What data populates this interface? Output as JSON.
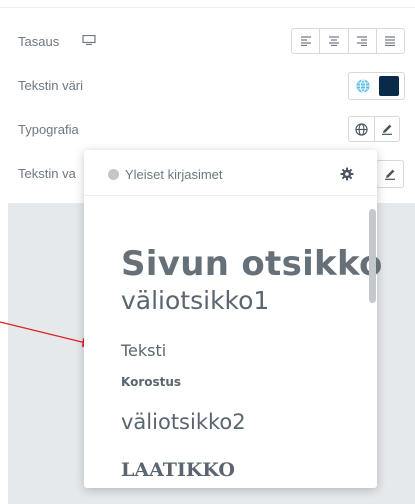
{
  "controls": {
    "alignment": {
      "label": "Tasaus",
      "icon": "monitor-icon",
      "options": [
        "align-left-icon",
        "align-center-icon",
        "align-right-icon",
        "align-justify-icon"
      ]
    },
    "text_color": {
      "label": "Tekstin väri",
      "globe_icon": "globe-icon",
      "swatch_color": "#0a2a4a"
    },
    "typography": {
      "label": "Typografia",
      "globe_icon": "globe-icon",
      "edit_icon": "pencil-icon"
    },
    "text_stroke": {
      "label": "Tekstin va",
      "edit_icon": "pencil-icon"
    }
  },
  "global_fonts_popup": {
    "title": "Yleiset kirjasimet",
    "settings_icon": "gear-icon",
    "items": [
      "Sivun otsikko",
      "väliotsikko1",
      "Teksti",
      "Korostus",
      "väliotsikko2",
      "LAATIKKO"
    ]
  },
  "colors": {
    "accent_globe": "#61ce70",
    "arrow": "#e02020",
    "swatch": "#0a2a4a"
  }
}
